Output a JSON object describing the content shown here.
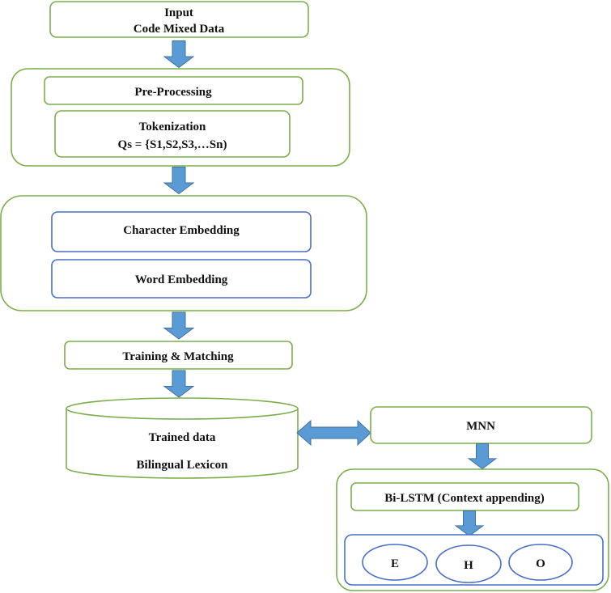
{
  "input": {
    "line1": "Input",
    "line2": "Code Mixed Data"
  },
  "preprocessing": {
    "label": "Pre-Processing"
  },
  "tokenization": {
    "line1": "Tokenization",
    "line2": "Qs = {S1,S2,S3,…Sn)"
  },
  "embeddings": {
    "character": "Character Embedding",
    "word": "Word Embedding"
  },
  "training": {
    "label": "Training & Matching"
  },
  "database": {
    "line1": "Trained data",
    "line2": "Bilingual Lexicon"
  },
  "mnn": {
    "label": "MNN"
  },
  "bilstm": {
    "label": "Bi-LSTM (Context appending)"
  },
  "outputs": [
    "E",
    "H",
    "O"
  ],
  "colors": {
    "green_border": "#7cad4c",
    "blue_border": "#4a6fc4",
    "arrow": "#5b9bd5"
  }
}
